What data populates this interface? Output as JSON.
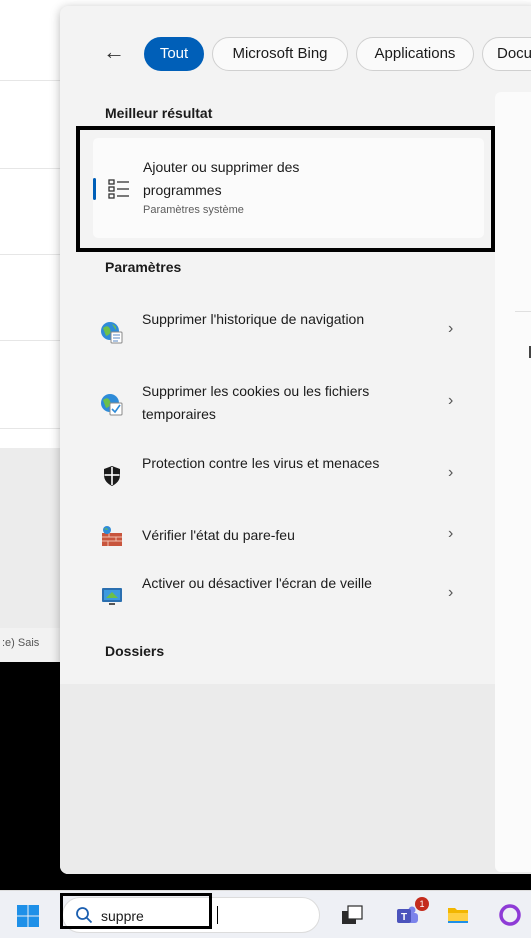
{
  "background": {
    "status_text": ":e)  Sais"
  },
  "search_panel": {
    "filters": [
      {
        "label": "Tout",
        "active": true
      },
      {
        "label": "Microsoft Bing",
        "active": false
      },
      {
        "label": "Applications",
        "active": false
      },
      {
        "label": "Docu",
        "active": false
      }
    ],
    "best_match": {
      "section_title": "Meilleur résultat",
      "title": "Ajouter ou supprimer des programmes",
      "subtitle": "Paramètres système",
      "icon": "list-settings-icon"
    },
    "settings": {
      "section_title": "Paramètres",
      "items": [
        {
          "label": "Supprimer l'historique de navigation",
          "icon": "globe-history-icon"
        },
        {
          "label": "Supprimer les cookies ou les fichiers temporaires",
          "icon": "globe-cookie-icon"
        },
        {
          "label": "Protection contre les virus et menaces",
          "icon": "shield-icon"
        },
        {
          "label": "Vérifier l'état du pare-feu",
          "icon": "firewall-icon"
        },
        {
          "label": "Activer ou désactiver l'écran de veille",
          "icon": "screensaver-icon"
        }
      ]
    },
    "folders": {
      "section_title": "Dossiers"
    }
  },
  "taskbar": {
    "search_value": "suppre",
    "teams_badge": "1",
    "icons": [
      "windows-start-icon",
      "search-icon",
      "task-view-icon",
      "teams-icon",
      "file-explorer-icon",
      "cortana-icon"
    ]
  },
  "colors": {
    "accent": "#005fb8",
    "badge": "#c42b1c"
  }
}
